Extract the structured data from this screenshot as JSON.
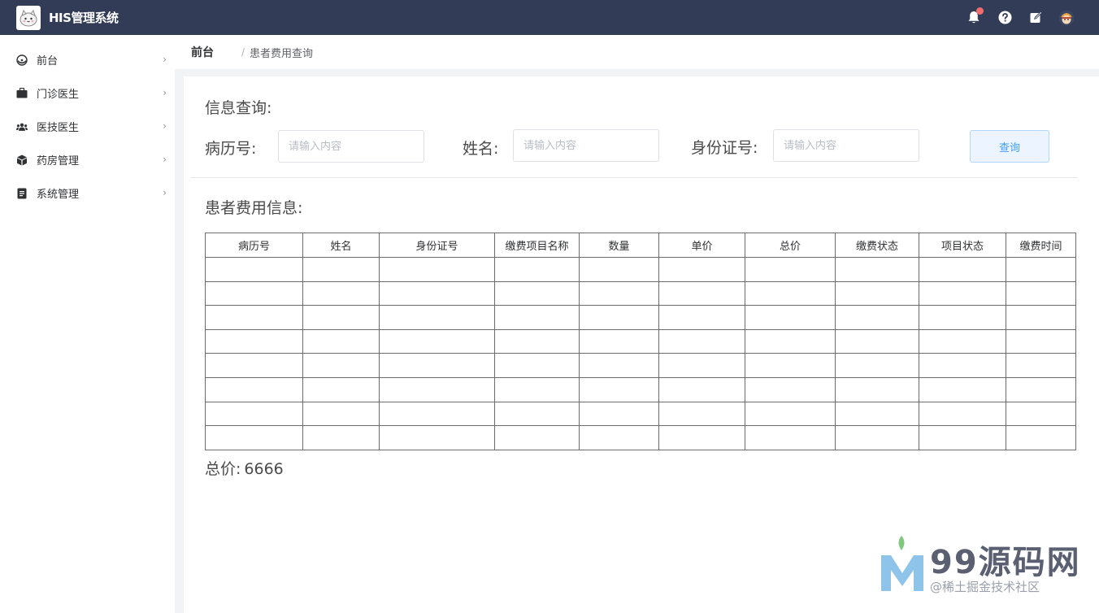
{
  "header": {
    "app_title": "HIS管理系统",
    "icons": [
      "bell-icon",
      "help-icon",
      "edit-icon",
      "user-avatar"
    ],
    "badge_color": "#f56c6c"
  },
  "sidebar": {
    "items": [
      {
        "label": "前台",
        "icon": "dashboard-icon"
      },
      {
        "label": "门诊医生",
        "icon": "briefcase-icon"
      },
      {
        "label": "医技医生",
        "icon": "users-icon"
      },
      {
        "label": "药房管理",
        "icon": "box-icon"
      },
      {
        "label": "系统管理",
        "icon": "document-icon"
      }
    ]
  },
  "breadcrumb": {
    "home": "前台",
    "separator": "/",
    "current": "患者费用查询"
  },
  "query": {
    "title": "信息查询:",
    "fields": [
      {
        "label": "病历号:",
        "placeholder": "请输入内容",
        "value": ""
      },
      {
        "label": "姓名:",
        "placeholder": "请输入内容",
        "value": ""
      },
      {
        "label": "身份证号:",
        "placeholder": "请输入内容",
        "value": ""
      }
    ],
    "button_label": "查询"
  },
  "fee_info": {
    "title": "患者费用信息:",
    "columns": [
      "病历号",
      "姓名",
      "身份证号",
      "缴费项目名称",
      "数量",
      "单价",
      "总价",
      "缴费状态",
      "项目状态",
      "缴费时间"
    ],
    "rows": [
      [
        "",
        "",
        "",
        "",
        "",
        "",
        "",
        "",
        "",
        ""
      ],
      [
        "",
        "",
        "",
        "",
        "",
        "",
        "",
        "",
        "",
        ""
      ],
      [
        "",
        "",
        "",
        "",
        "",
        "",
        "",
        "",
        "",
        ""
      ],
      [
        "",
        "",
        "",
        "",
        "",
        "",
        "",
        "",
        "",
        ""
      ],
      [
        "",
        "",
        "",
        "",
        "",
        "",
        "",
        "",
        "",
        ""
      ],
      [
        "",
        "",
        "",
        "",
        "",
        "",
        "",
        "",
        "",
        ""
      ],
      [
        "",
        "",
        "",
        "",
        "",
        "",
        "",
        "",
        "",
        ""
      ],
      [
        "",
        "",
        "",
        "",
        "",
        "",
        "",
        "",
        "",
        ""
      ]
    ],
    "total_label": "总价:",
    "total_value": "6666"
  },
  "watermark": {
    "brand": "99源码网",
    "sub": "@稀土掘金技术社区"
  },
  "colors": {
    "header_bg": "#323c56",
    "accent": "#409eff",
    "button_bg": "#ecf5ff"
  }
}
